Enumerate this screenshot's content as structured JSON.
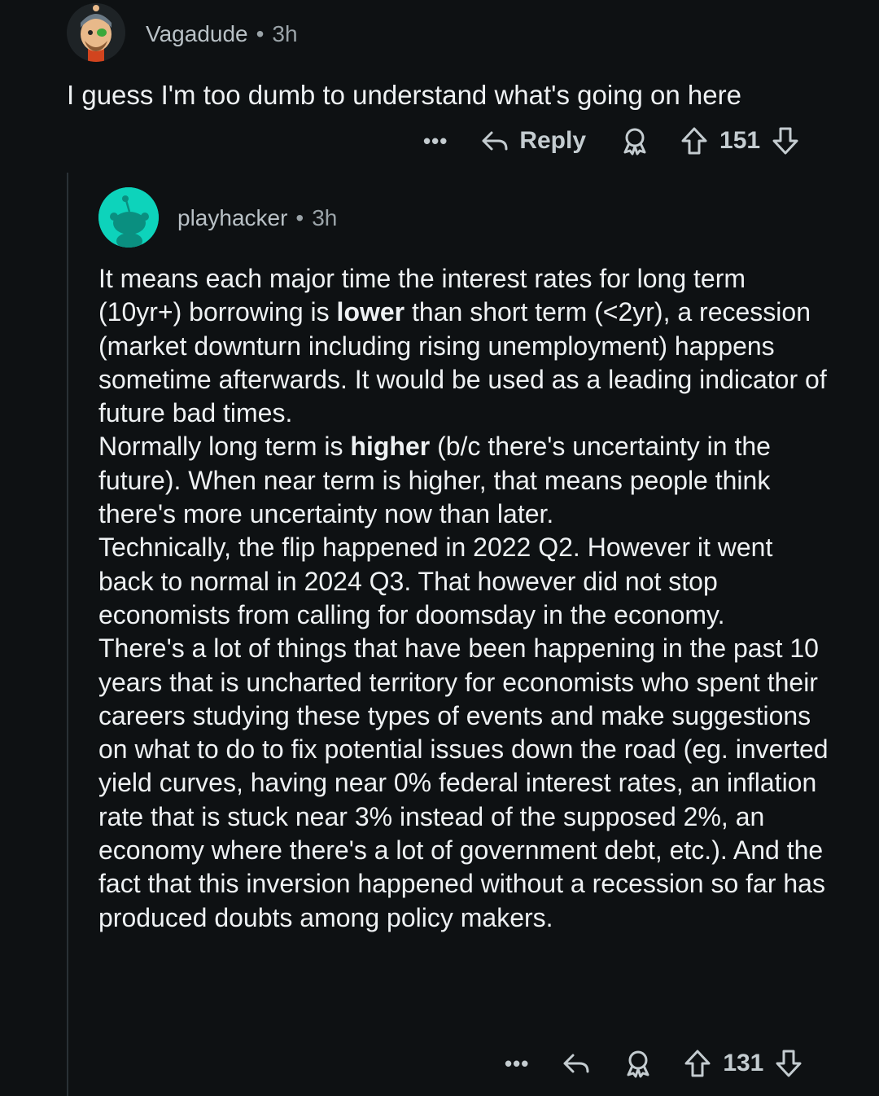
{
  "comment1": {
    "username": "Vagadude",
    "separator": "•",
    "time": "3h",
    "text": "I guess I'm too dumb to understand what's going on here",
    "actions": {
      "more": "•••",
      "reply_label": "Reply",
      "score": "151"
    }
  },
  "comment2": {
    "username": "playhacker",
    "separator": "•",
    "time": "3h",
    "para1": {
      "t1": "It means each major time the interest rates for long term (10yr+) borrowing is ",
      "b1": "lower",
      "t2": " than short term (<2yr), a recession (market downturn including rising unemployment) happens sometime afterwards. It would be used as a leading indicator of future bad times."
    },
    "para2": {
      "t1": "Normally long term is ",
      "b1": "higher",
      "t2": " (b/c there's uncertainty in the future). When near term is higher, that means people think there's more uncertainty now than later."
    },
    "para3": "Technically, the flip happened in 2022 Q2. However it went back to normal in 2024 Q3. That however did not stop economists from calling for doomsday in the economy.",
    "para4": "There's a lot of things that have been happening in the past 10 years that is uncharted territory for economists who spent their careers studying these types of events and make suggestions on what to do to fix potential issues down the road (eg. inverted yield curves, having near 0% federal interest rates, an inflation rate that is stuck near 3% instead of the supposed 2%, an economy where there's a lot of government debt, etc.). And the fact that this inversion happened without a recession so far has produced doubts among policy makers.",
    "actions": {
      "more": "•••",
      "score": "131"
    }
  },
  "icons": [
    "avatar",
    "more-icon",
    "reply-icon",
    "award-icon",
    "upvote-icon",
    "downvote-icon"
  ],
  "colors": {
    "background": "#0e1113",
    "text": "#eef1f3",
    "muted": "#9aa3a8",
    "snoo_teal": "#0dd3bb"
  }
}
